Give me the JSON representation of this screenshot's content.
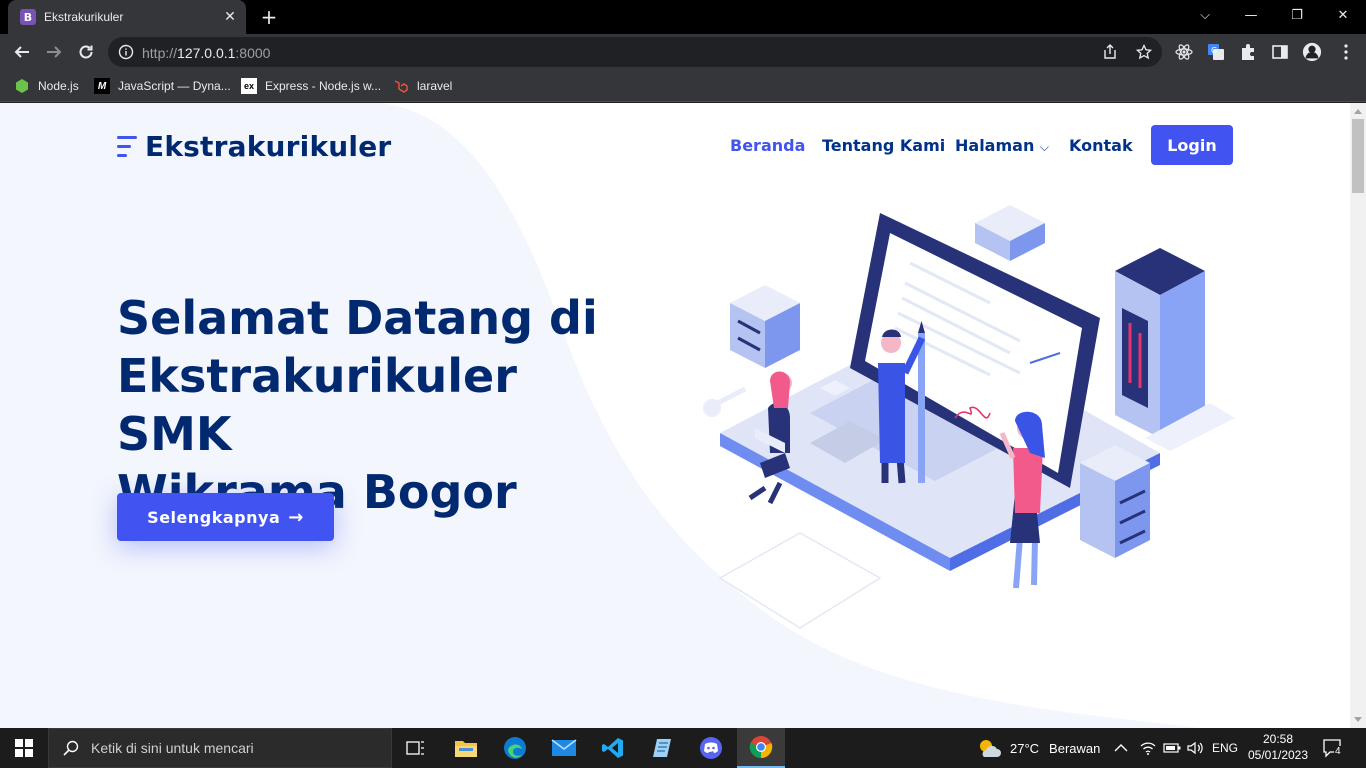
{
  "browser": {
    "tab": {
      "title": "Ekstrakurikuler",
      "favicon_letter": "B",
      "close_glyph": "✕"
    },
    "new_tab_glyph": "+",
    "window_controls": {
      "dropdown": "⌵",
      "minimize": "—",
      "restore": "❐",
      "close": "✕"
    },
    "address": {
      "scheme": "http://",
      "host": "127.0.0.1",
      "port": ":8000"
    },
    "bookmarks": [
      {
        "label": "Node.js",
        "icon": "nodejs-hexagon-icon"
      },
      {
        "label": "JavaScript — Dyna...",
        "icon": "mdn-m-icon"
      },
      {
        "label": "Express - Node.js w...",
        "icon": "express-ex-icon"
      },
      {
        "label": "laravel",
        "icon": "laravel-icon"
      }
    ],
    "bookmark_icon_text": {
      "mdn": "M",
      "express": "ex"
    }
  },
  "site": {
    "brand": "Ekstrakurikuler",
    "nav": {
      "home": "Beranda",
      "about": "Tentang Kami",
      "pages": "Halaman",
      "pages_chevron": "⌵",
      "contact": "Kontak",
      "login": "Login"
    },
    "hero": {
      "line1": "Selamat Datang di",
      "line2": "Ekstrakurikuler SMK",
      "line3": "Wikrama Bogor",
      "cta": "Selengkapnya",
      "cta_arrow": "→"
    }
  },
  "taskbar": {
    "search_placeholder": "Ketik di sini untuk mencari",
    "weather": {
      "temp": "27°C",
      "condition": "Berawan"
    },
    "language": "ENG",
    "time": "20:58",
    "date": "05/01/2023",
    "notification_count": "4"
  },
  "colors": {
    "accent": "#4154f1",
    "navy": "#012970",
    "chrome_dark": "#202124",
    "chrome_mid": "#35363a"
  }
}
